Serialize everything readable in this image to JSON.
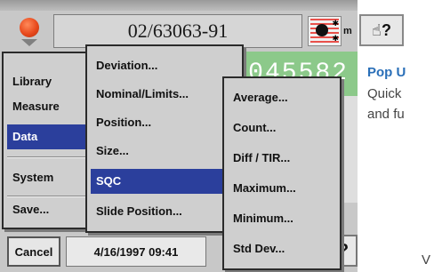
{
  "header": {
    "title": "02/63063-91",
    "m_label": "m",
    "help_label": "☝?"
  },
  "readout": {
    "value": "045582"
  },
  "main_menu": {
    "items": [
      {
        "label": "Library"
      },
      {
        "label": "Measure"
      },
      {
        "label": "Data",
        "selected": true
      },
      {
        "label": "System"
      },
      {
        "label": "Save..."
      }
    ]
  },
  "data_menu": {
    "items": [
      {
        "label": "Deviation..."
      },
      {
        "label": "Nominal/Limits..."
      },
      {
        "label": "Position..."
      },
      {
        "label": "Size..."
      },
      {
        "label": "SQC",
        "selected": true
      },
      {
        "label": "Slide Position..."
      }
    ]
  },
  "sqc_menu": {
    "items": [
      {
        "label": "Average..."
      },
      {
        "label": "Count..."
      },
      {
        "label": "Diff / TIR..."
      },
      {
        "label": "Maximum..."
      },
      {
        "label": "Minimum..."
      },
      {
        "label": "Std Dev..."
      }
    ]
  },
  "footer": {
    "cancel_label": "Cancel",
    "datetime": "4/16/1997 09:41",
    "help_label": "?"
  },
  "side_panel": {
    "title": "Pop U",
    "lines": [
      "Quick",
      "and fu"
    ],
    "bottom_letter": "V"
  },
  "colors": {
    "selection": "#2b3f9c",
    "readout_bg": "#8cc98a",
    "side_title": "#2a6fb8"
  }
}
